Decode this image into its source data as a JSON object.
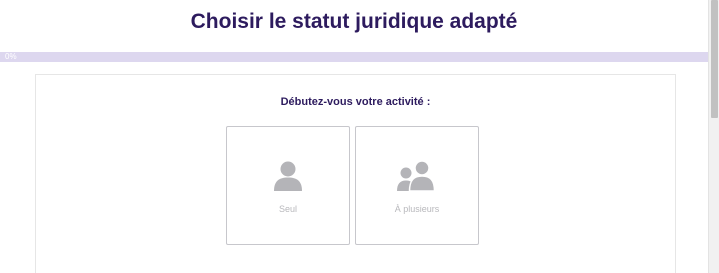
{
  "header": {
    "title": "Choisir le statut juridique adapté"
  },
  "progress": {
    "label": "0%",
    "value_percent": 0
  },
  "step": {
    "question": "Débutez-vous votre activité :",
    "options": [
      {
        "label": "Seul",
        "icon": "single-person-icon"
      },
      {
        "label": "À plusieurs",
        "icon": "group-people-icon"
      }
    ]
  },
  "colors": {
    "title": "#2d1b5e",
    "progress_track": "#ddd7ef",
    "progress_fill": "#5b3fa8",
    "option_border": "#c7c7cc",
    "icon_fill": "#b4b4b8",
    "option_label": "#b8b8bc"
  }
}
